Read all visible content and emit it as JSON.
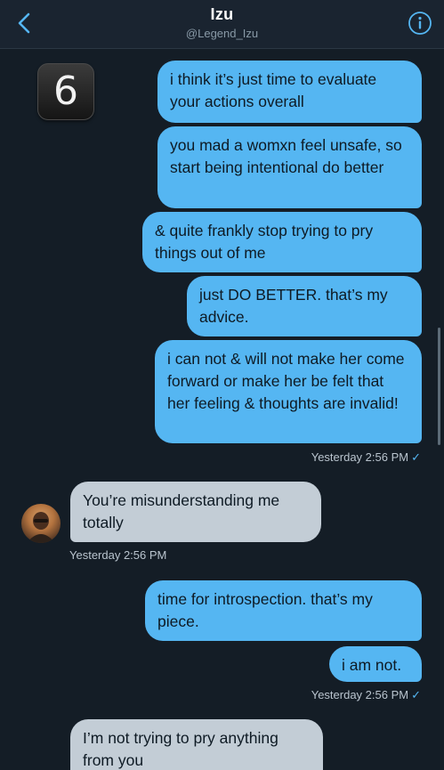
{
  "header": {
    "title": "Izu",
    "handle": "@Legend_Izu"
  },
  "badge": "6",
  "messages": [
    {
      "text": "i think it’s just time to evaluate your actions overall"
    },
    {
      "text": "you mad a womxn feel unsafe, so start being intentional do better"
    },
    {
      "text": "& quite frankly stop trying to pry things out of me"
    },
    {
      "text": "just DO BETTER. that’s my advice."
    },
    {
      "text": "i can not & will not make her come forward or make her be felt that her feeling & thoughts are invalid!"
    },
    {
      "text": "You’re misunderstanding me totally"
    },
    {
      "text": "time for introspection. that’s my piece."
    },
    {
      "text": "i am not."
    },
    {
      "text": "I’m not trying to pry anything from you"
    }
  ],
  "timestamps": {
    "t1": "Yesterday 2:56 PM",
    "t2": "Yesterday 2:56 PM",
    "t3": "Yesterday 2:56 PM"
  },
  "colors": {
    "background": "#141d26",
    "outgoing_bubble": "#55b6f2",
    "incoming_bubble": "#c3cdd6"
  },
  "icons": {
    "back": "chevron-left-icon",
    "info": "info-circle-icon",
    "read": "checkmark-icon"
  }
}
